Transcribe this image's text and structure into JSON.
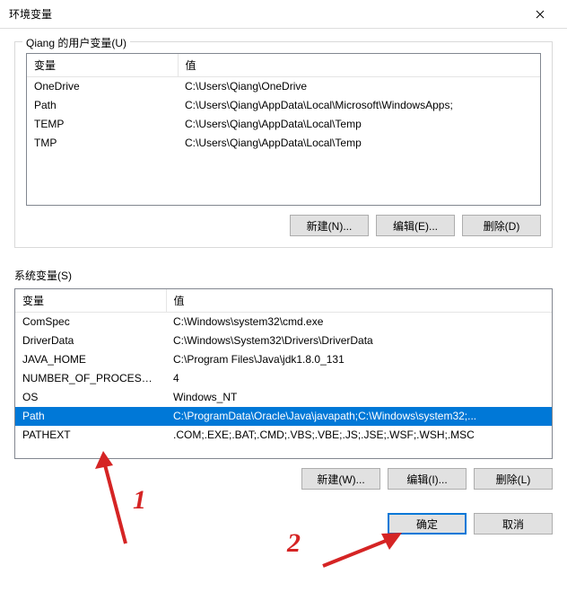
{
  "title": "环境变量",
  "userGroup": {
    "label": "Qiang 的用户变量(U)",
    "headers": [
      "变量",
      "值"
    ],
    "rows": [
      [
        "OneDrive",
        "C:\\Users\\Qiang\\OneDrive"
      ],
      [
        "Path",
        "C:\\Users\\Qiang\\AppData\\Local\\Microsoft\\WindowsApps;"
      ],
      [
        "TEMP",
        "C:\\Users\\Qiang\\AppData\\Local\\Temp"
      ],
      [
        "TMP",
        "C:\\Users\\Qiang\\AppData\\Local\\Temp"
      ]
    ],
    "buttons": {
      "new": "新建(N)...",
      "edit": "编辑(E)...",
      "delete": "删除(D)"
    }
  },
  "sysGroup": {
    "label": "系统变量(S)",
    "headers": [
      "变量",
      "值"
    ],
    "rows": [
      [
        "ComSpec",
        "C:\\Windows\\system32\\cmd.exe"
      ],
      [
        "DriverData",
        "C:\\Windows\\System32\\Drivers\\DriverData"
      ],
      [
        "JAVA_HOME",
        "C:\\Program Files\\Java\\jdk1.8.0_131"
      ],
      [
        "NUMBER_OF_PROCESSORS",
        "4"
      ],
      [
        "OS",
        "Windows_NT"
      ],
      [
        "Path",
        "C:\\ProgramData\\Oracle\\Java\\javapath;C:\\Windows\\system32;..."
      ],
      [
        "PATHEXT",
        ".COM;.EXE;.BAT;.CMD;.VBS;.VBE;.JS;.JSE;.WSF;.WSH;.MSC"
      ]
    ],
    "selectedIndex": 5,
    "buttons": {
      "new": "新建(W)...",
      "edit": "编辑(I)...",
      "delete": "删除(L)"
    }
  },
  "dialogButtons": {
    "ok": "确定",
    "cancel": "取消"
  },
  "annotations": {
    "num1": "1",
    "num2": "2"
  }
}
